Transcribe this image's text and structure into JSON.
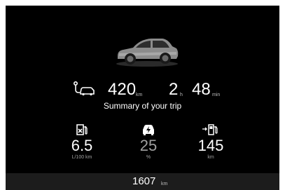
{
  "trip": {
    "distance_value": "420",
    "distance_unit": "km",
    "hours_value": "2",
    "hours_unit": "h",
    "minutes_value": "48",
    "minutes_unit": "min",
    "summary_label": "Summary of your trip"
  },
  "stats": [
    {
      "icon": "fuel-consumption-icon",
      "value": "6.5",
      "unit": "L/100 km"
    },
    {
      "icon": "electric-drive-icon",
      "value": "25",
      "unit": "%"
    },
    {
      "icon": "fuel-range-icon",
      "value": "145",
      "unit": "km"
    }
  ],
  "footer": {
    "odometer_value": "1607",
    "odometer_unit": "km"
  },
  "colors": {
    "background": "#000000",
    "text": "#ffffff",
    "footer_bar": "#1c1c1c",
    "muted": "#a0a0a0"
  }
}
